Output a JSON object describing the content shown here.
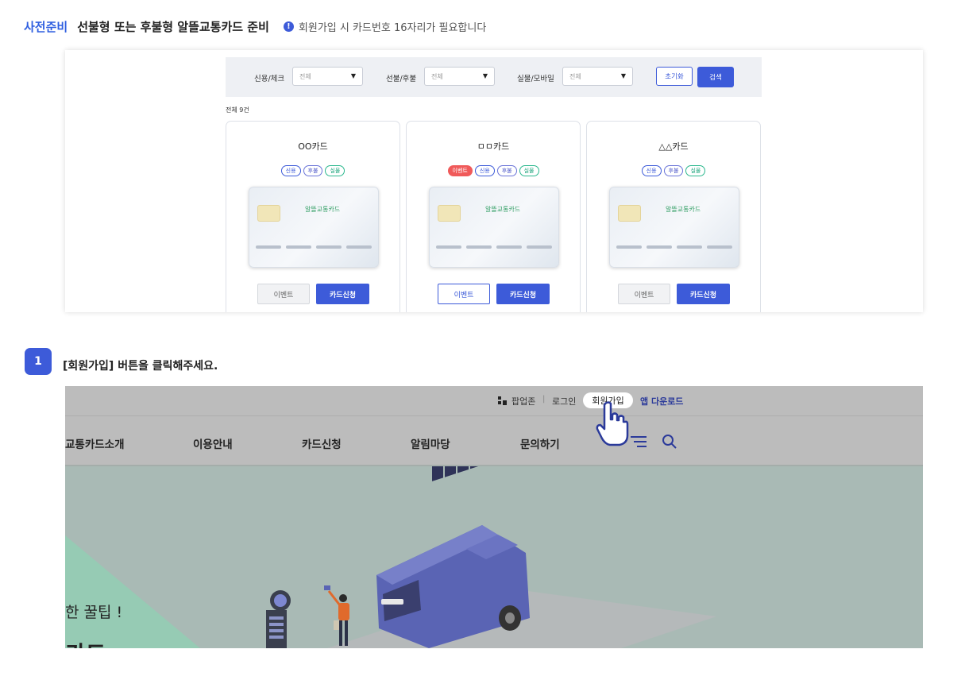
{
  "header": {
    "tag": "사전준비",
    "title": "선불형 또는 후불형 알뜰교통카드 준비",
    "info_icon_glyph": "!",
    "note": "회원가입 시 카드번호 16자리가 필요합니다"
  },
  "filter": {
    "credit_label": "신용/체크",
    "credit_value": "전체",
    "prepost_label": "선불/후불",
    "prepost_value": "전체",
    "physical_label": "실물/모바일",
    "physical_value": "전체",
    "reset_label": "초기화",
    "search_label": "검색",
    "dropdown_arrow": "▼"
  },
  "total_label": "전체 9건",
  "cards": [
    {
      "name": "OO카드",
      "badges": [
        "신용",
        "후불",
        "실물"
      ],
      "logo": "알뜰교통카드",
      "event_label": "이벤트",
      "apply_label": "카드신청"
    },
    {
      "name": "ㅁㅁ카드",
      "badges": [
        "이벤트",
        "신용",
        "후불",
        "실물"
      ],
      "logo": "알뜰교통카드",
      "event_label": "이벤트",
      "apply_label": "카드신청"
    },
    {
      "name": "△△카드",
      "badges": [
        "신용",
        "후불",
        "실물"
      ],
      "logo": "알뜰교통카드",
      "event_label": "이벤트",
      "apply_label": "카드신청"
    }
  ],
  "step": {
    "number": "1",
    "text": "[회원가입] 버튼을 클릭해주세요."
  },
  "site": {
    "popup_zone": "팝업존",
    "login": "로그인",
    "separator": "|",
    "signup": "회원가입",
    "app_download": "앱 다운로드",
    "nav": [
      "교통카드소개",
      "이용안내",
      "카드신청",
      "알림마당",
      "문의하기"
    ],
    "hero_line1": "한 꿀팁 !",
    "hero_line2": "카드"
  },
  "colors": {
    "accent": "#3d5bd9",
    "event_badge": "#f05a5a",
    "bus": "#5a64b4"
  }
}
